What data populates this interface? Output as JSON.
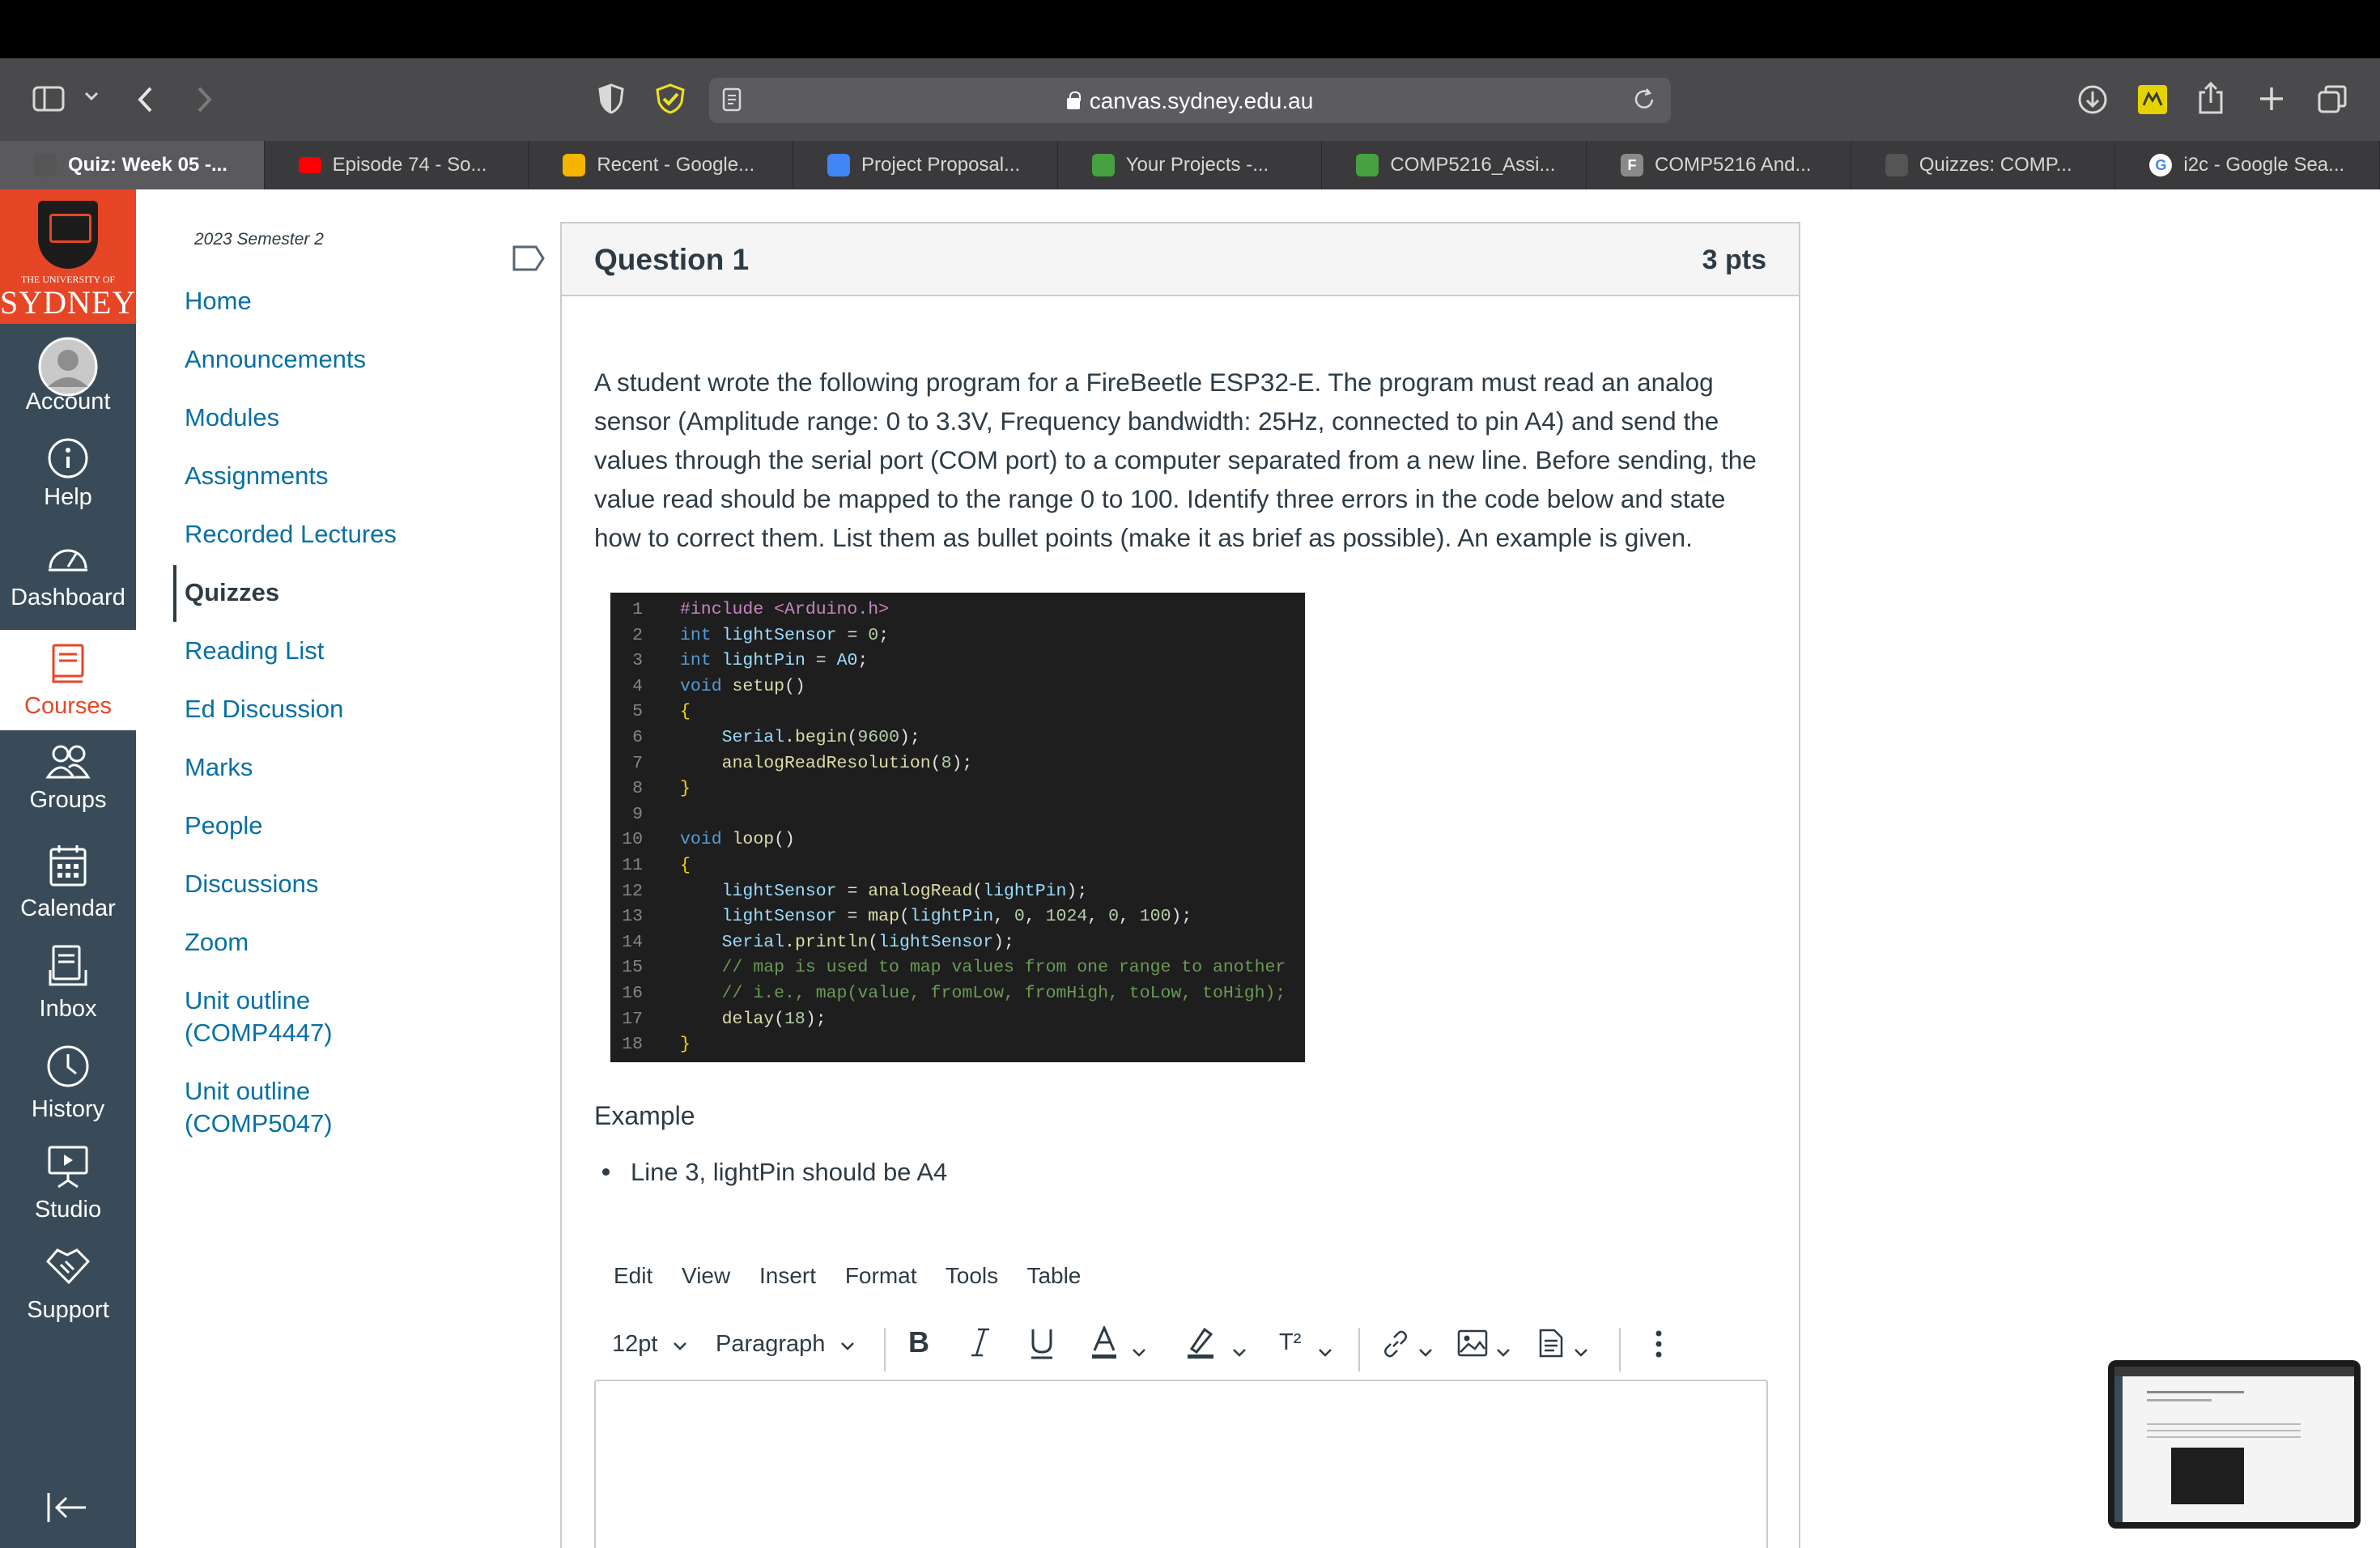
{
  "browser": {
    "url": "canvas.sydney.edu.au",
    "tabs": [
      {
        "label": "Quiz: Week 05 -...",
        "favicon": "usyd-crest",
        "color": "#555555"
      },
      {
        "label": "Episode 74 - So...",
        "favicon": "youtube-icon",
        "color": "#ff0000"
      },
      {
        "label": "Recent - Google...",
        "favicon": "google-drive-icon",
        "color": "#f4b400"
      },
      {
        "label": "Project Proposal...",
        "favicon": "google-docs-icon",
        "color": "#4285f4"
      },
      {
        "label": "Your Projects -...",
        "favicon": "overleaf-icon",
        "color": "#47a141"
      },
      {
        "label": "COMP5216_Assi...",
        "favicon": "overleaf-icon",
        "color": "#47a141"
      },
      {
        "label": "COMP5216 And...",
        "favicon": "letter-f-icon",
        "color": "#8a8a8a"
      },
      {
        "label": "Quizzes: COMP...",
        "favicon": "usyd-crest",
        "color": "#555555"
      },
      {
        "label": "i2c - Google Sea...",
        "favicon": "google-icon",
        "color": "#ffffff"
      }
    ]
  },
  "brand": {
    "uni_line": "THE UNIVERSITY OF",
    "name": "SYDNEY",
    "color": "#e64626"
  },
  "global_nav": [
    {
      "label": "Account",
      "icon": "account-avatar-icon"
    },
    {
      "label": "Help",
      "icon": "info-icon"
    },
    {
      "label": "Dashboard",
      "icon": "dashboard-gauge-icon"
    },
    {
      "label": "Courses",
      "icon": "courses-book-icon",
      "active": true
    },
    {
      "label": "Groups",
      "icon": "groups-icon"
    },
    {
      "label": "Calendar",
      "icon": "calendar-icon"
    },
    {
      "label": "Inbox",
      "icon": "inbox-icon"
    },
    {
      "label": "History",
      "icon": "clock-icon"
    },
    {
      "label": "Studio",
      "icon": "studio-icon"
    },
    {
      "label": "Support",
      "icon": "handshake-icon"
    }
  ],
  "course_nav": {
    "semester": "2023 Semester 2",
    "items": [
      {
        "label": "Home"
      },
      {
        "label": "Announcements"
      },
      {
        "label": "Modules"
      },
      {
        "label": "Assignments"
      },
      {
        "label": "Recorded Lectures"
      },
      {
        "label": "Quizzes",
        "active": true
      },
      {
        "label": "Reading List"
      },
      {
        "label": "Ed Discussion"
      },
      {
        "label": "Marks"
      },
      {
        "label": "People"
      },
      {
        "label": "Discussions"
      },
      {
        "label": "Zoom"
      },
      {
        "label": "Unit outline (COMP4447)",
        "line1": "Unit outline",
        "line2": "(COMP4447)"
      },
      {
        "label": "Unit outline (COMP5047)",
        "line1": "Unit outline",
        "line2": "(COMP5047)"
      }
    ]
  },
  "question": {
    "title": "Question 1",
    "points": "3 pts",
    "text_lines": [
      "A student wrote the following program for a FireBeetle ESP32-E. The program must read an analog",
      "sensor (Amplitude range: 0 to 3.3V, Frequency bandwidth: 25Hz, connected to pin A4) and send the",
      "values through the serial port (COM port) to a computer separated from a new line. Before sending, the",
      "value read should be mapped to the range 0 to 100. Identify three errors in the code below and state",
      "how to correct them. List them as bullet points (make it as brief as possible). An example is given."
    ],
    "code": [
      {
        "n": "1",
        "text": "#include <Arduino.h>"
      },
      {
        "n": "2",
        "text": "int lightSensor = 0;"
      },
      {
        "n": "3",
        "text": "int lightPin = A0;"
      },
      {
        "n": "4",
        "text": "void setup()"
      },
      {
        "n": "5",
        "text": "{"
      },
      {
        "n": "6",
        "text": "    Serial.begin(9600);"
      },
      {
        "n": "7",
        "text": "    analogReadResolution(8);"
      },
      {
        "n": "8",
        "text": "}"
      },
      {
        "n": "9",
        "text": ""
      },
      {
        "n": "10",
        "text": "void loop()"
      },
      {
        "n": "11",
        "text": "{"
      },
      {
        "n": "12",
        "text": "    lightSensor = analogRead(lightPin);"
      },
      {
        "n": "13",
        "text": "    lightSensor = map(lightPin, 0, 1024, 0, 100);"
      },
      {
        "n": "14",
        "text": "    Serial.println(lightSensor);"
      },
      {
        "n": "15",
        "text": "    // map is used to map values from one range to another"
      },
      {
        "n": "16",
        "text": "    // i.e., map(value, fromLow, fromHigh, toLow, toHigh);"
      },
      {
        "n": "17",
        "text": "    delay(18);"
      },
      {
        "n": "18",
        "text": "}"
      }
    ],
    "example_label": "Example",
    "example_bullet": "Line 3, lightPin should be A4"
  },
  "editor": {
    "menu": [
      "Edit",
      "View",
      "Insert",
      "Format",
      "Tools",
      "Table"
    ],
    "font_size": "12pt",
    "block_format": "Paragraph",
    "superscript_label": "T²"
  }
}
